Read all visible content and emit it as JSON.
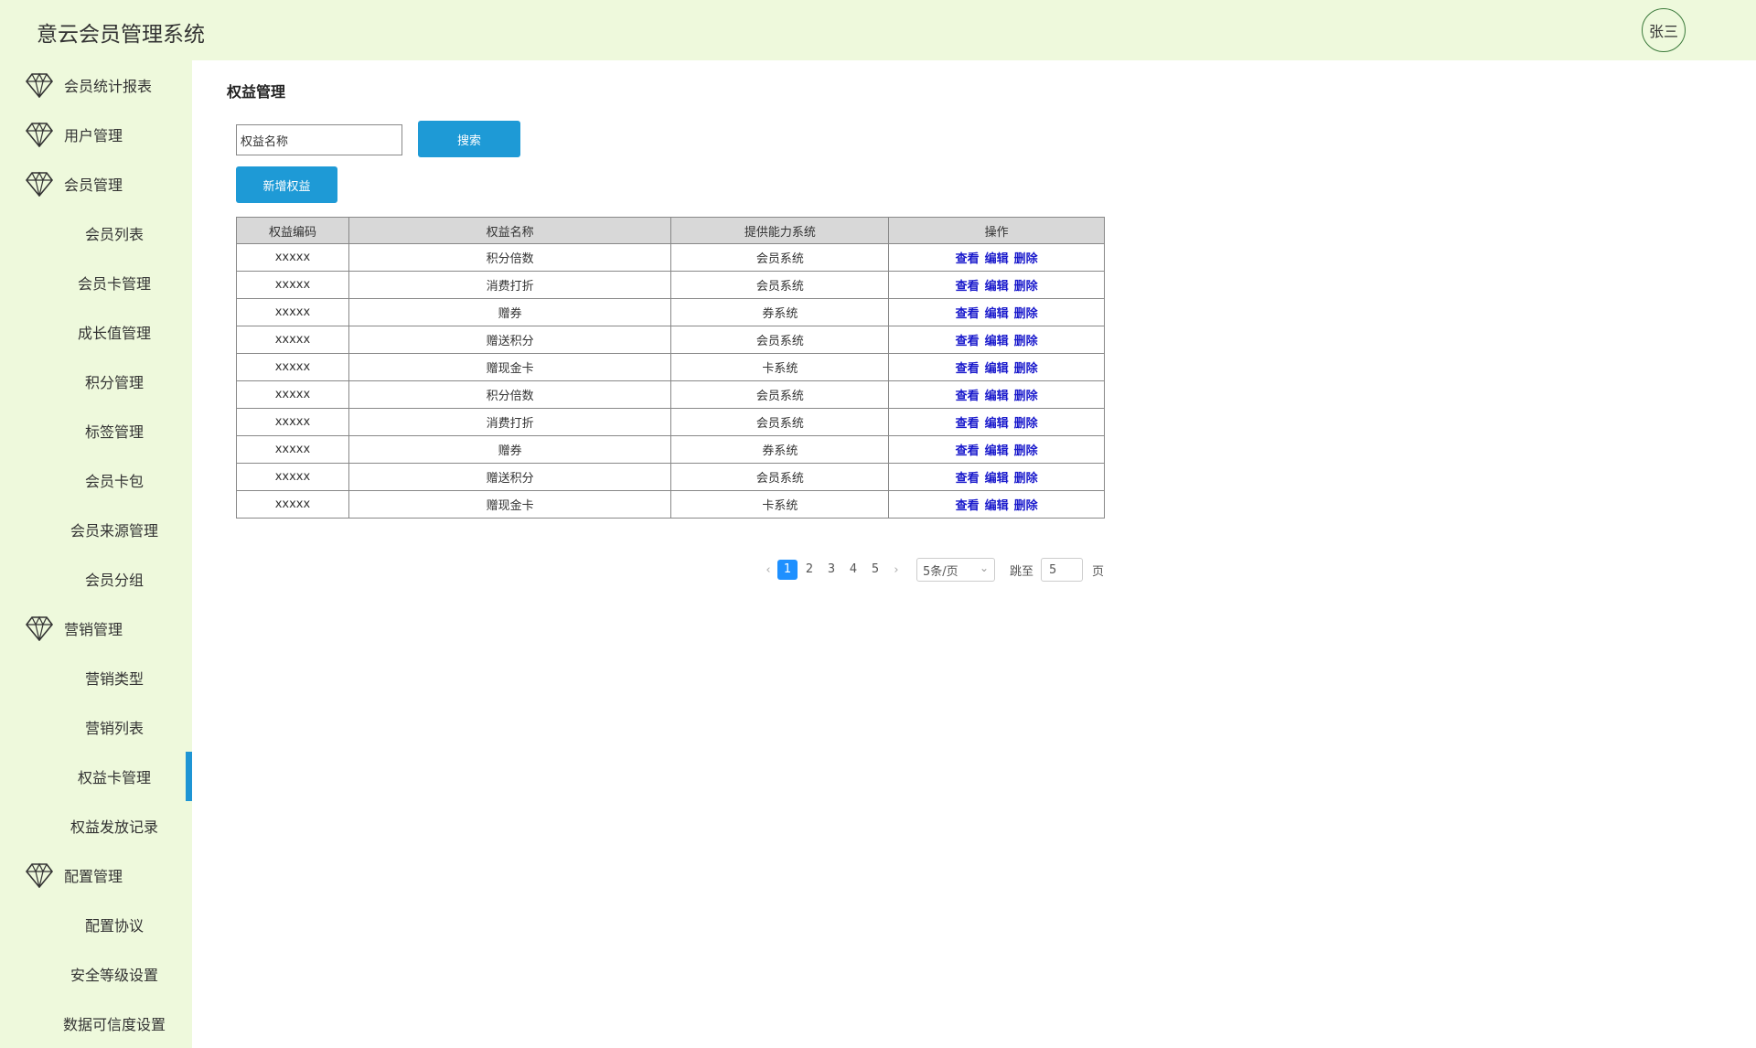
{
  "app": {
    "title": "意云会员管理系统",
    "user": "张三"
  },
  "sidebar": {
    "items": [
      {
        "label": "会员统计报表",
        "group": true
      },
      {
        "label": "用户管理",
        "group": true
      },
      {
        "label": "会员管理",
        "group": true
      },
      {
        "label": "会员列表"
      },
      {
        "label": "会员卡管理"
      },
      {
        "label": "成长值管理"
      },
      {
        "label": "积分管理"
      },
      {
        "label": "标签管理"
      },
      {
        "label": "会员卡包"
      },
      {
        "label": "会员来源管理"
      },
      {
        "label": "会员分组"
      },
      {
        "label": "营销管理",
        "group": true
      },
      {
        "label": "营销类型"
      },
      {
        "label": "营销列表"
      },
      {
        "label": "权益卡管理",
        "active": true
      },
      {
        "label": "权益发放记录"
      },
      {
        "label": "配置管理",
        "group": true
      },
      {
        "label": "配置协议"
      },
      {
        "label": "安全等级设置"
      },
      {
        "label": "数据可信度设置"
      }
    ]
  },
  "main": {
    "title": "权益管理",
    "search": {
      "value": "权益名称",
      "button": "搜索"
    },
    "add_button": "新增权益",
    "table": {
      "headers": [
        "权益编码",
        "权益名称",
        "提供能力系统",
        "操作"
      ],
      "actions": [
        "查看",
        "编辑",
        "删除"
      ],
      "rows": [
        [
          "xxxxx",
          "积分倍数",
          "会员系统"
        ],
        [
          "xxxxx",
          "消费打折",
          "会员系统"
        ],
        [
          "xxxxx",
          "赠券",
          "券系统"
        ],
        [
          "xxxxx",
          "赠送积分",
          "会员系统"
        ],
        [
          "xxxxx",
          "赠现金卡",
          "卡系统"
        ],
        [
          "xxxxx",
          "积分倍数",
          "会员系统"
        ],
        [
          "xxxxx",
          "消费打折",
          "会员系统"
        ],
        [
          "xxxxx",
          "赠券",
          "券系统"
        ],
        [
          "xxxxx",
          "赠送积分",
          "会员系统"
        ],
        [
          "xxxxx",
          "赠现金卡",
          "卡系统"
        ]
      ]
    },
    "pagination": {
      "pages": [
        "1",
        "2",
        "3",
        "4",
        "5"
      ],
      "current": "1",
      "page_size": "5条/页",
      "goto_label": "跳至",
      "goto_value": "5",
      "unit": "页"
    }
  },
  "colors": {
    "accent": "#1e9ad6",
    "sidebar_bg": "#eef9dc",
    "link": "#1a1acc"
  }
}
